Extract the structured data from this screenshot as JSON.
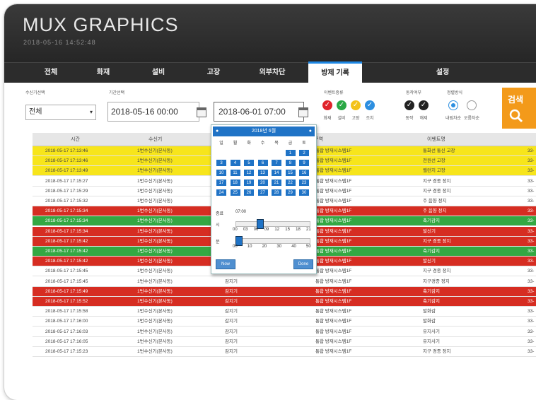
{
  "app": {
    "brand": "MUX GRAPHICS",
    "datetime": "2018-05-16 14:52:48"
  },
  "nav": {
    "tabs": [
      "전체",
      "화재",
      "설비",
      "고장",
      "외부차단",
      "방제 기록",
      "설정"
    ]
  },
  "filters": {
    "receiver_label": "수신기선택",
    "receiver_value": "전체",
    "period_label": "기간선택",
    "start": "2018-05-16 00:00",
    "end": "2018-06-01 07:00",
    "event_label": "이벤트종류",
    "events": [
      "화재",
      "설비",
      "고장",
      "조치"
    ],
    "events_colors": [
      "#e0232b",
      "#2aa845",
      "#f3c21b",
      "#2d8fe0"
    ],
    "status_label": "동작여부",
    "statuses": [
      "동작",
      "해제"
    ],
    "sort_label": "정렬방식",
    "sorts": [
      "내림차순",
      "오름차순"
    ],
    "search_label": "검색"
  },
  "table": {
    "headers": [
      "시간",
      "수신기",
      "",
      "구역",
      "이벤트명",
      ""
    ],
    "rows": [
      {
        "color": "yellow",
        "time": "2018-05-17 17:13:46",
        "rx": "1번수신기(본사동)",
        "type": "",
        "zone": "통합 방재시스템1F",
        "event": "통화선 통신 고장",
        "code": "33-"
      },
      {
        "color": "yellow",
        "time": "2018-05-17 17:13:46",
        "rx": "1번수신기(본사동)",
        "type": "",
        "zone": "통합 방재시스템1F",
        "event": "전원선 고장",
        "code": "33-"
      },
      {
        "color": "yellow",
        "time": "2018-05-17 17:13:49",
        "rx": "1번수신기(본사동)",
        "type": "",
        "zone": "통합 방재시스템1F",
        "event": "밸런지 고장",
        "code": "33-"
      },
      {
        "color": "white",
        "time": "2018-05-17 17:15:27",
        "rx": "1번수신기(본사동)",
        "type": "",
        "zone": "통합 방재시스템1F",
        "event": "지구 경종 정지",
        "code": "33-"
      },
      {
        "color": "white",
        "time": "2018-05-17 17:15:29",
        "rx": "1번수신기(본사동)",
        "type": "",
        "zone": "통합 방재시스템1F",
        "event": "지구 경종 정지",
        "code": "33-"
      },
      {
        "color": "white",
        "time": "2018-05-17 17:15:32",
        "rx": "1번수신기(본사동)",
        "type": "",
        "zone": "통합 방재시스템1F",
        "event": "주 음향 정지",
        "code": "33-"
      },
      {
        "color": "red",
        "time": "2018-05-17 17:15:34",
        "rx": "1번수신기(본사동)",
        "type": "",
        "zone": "통합 방재시스템1F",
        "event": "주 음향 정지",
        "code": "33-"
      },
      {
        "color": "green",
        "time": "2018-05-17 17:15:34",
        "rx": "1번수신기(본사동)",
        "type": "",
        "zone": "통합 방재시스템1F",
        "event": "축기감지",
        "code": "33-"
      },
      {
        "color": "red",
        "time": "2018-05-17 17:15:34",
        "rx": "1번수신기(본사동)",
        "type": "",
        "zone": "통합 방재시스템1F",
        "event": "발신기",
        "code": "33-"
      },
      {
        "color": "red",
        "time": "2018-05-17 17:15:42",
        "rx": "1번수신기(본사동)",
        "type": "",
        "zone": "통합 방재시스템1F",
        "event": "지구 경종 정지",
        "code": "33-"
      },
      {
        "color": "green",
        "time": "2018-05-17 17:15:42",
        "rx": "1번수신기(본사동)",
        "type": "",
        "zone": "통합 방재시스템1F",
        "event": "축기감지",
        "code": "33-"
      },
      {
        "color": "red",
        "time": "2018-05-17 17:15:42",
        "rx": "1번수신기(본사동)",
        "type": "감지기",
        "zone": "통합 방재시스템1F",
        "event": "발신기",
        "code": "33-"
      },
      {
        "color": "white",
        "time": "2018-05-17 17:15:45",
        "rx": "1번수신기(본사동)",
        "type": "감지기",
        "zone": "통합 방재시스템1F",
        "event": "지구 경종 정지",
        "code": "33-"
      },
      {
        "color": "white",
        "time": "2018-05-17 17:15:45",
        "rx": "1번수신기(본사동)",
        "type": "감지기",
        "zone": "통합 방재시스템1F",
        "event": "지구경종 정지",
        "code": "33-"
      },
      {
        "color": "red",
        "time": "2018-05-17 17:15:49",
        "rx": "1번수신기(본사동)",
        "type": "감지기",
        "zone": "통합 방재시스템1F",
        "event": "축기감지",
        "code": "33-"
      },
      {
        "color": "red",
        "time": "2018-05-17 17:15:52",
        "rx": "1번수신기(본사동)",
        "type": "감지기",
        "zone": "통합 방재시스템1F",
        "event": "축기감지",
        "code": "33-"
      },
      {
        "color": "white",
        "time": "2018-05-17 17:15:58",
        "rx": "1번수신기(본사동)",
        "type": "감지기",
        "zone": "통합 방재시스템1F",
        "event": "발화감",
        "code": "33-"
      },
      {
        "color": "white",
        "time": "2018-05-17 17:16:00",
        "rx": "1번수신기(본사동)",
        "type": "감지기",
        "zone": "통합 방재시스템1F",
        "event": "발화감",
        "code": "33-"
      },
      {
        "color": "white",
        "time": "2018-05-17 17:16:03",
        "rx": "1번수신기(본사동)",
        "type": "감지기",
        "zone": "통합 방재시스템1F",
        "event": "유지사기",
        "code": "33-"
      },
      {
        "color": "white",
        "time": "2018-05-17 17:16:05",
        "rx": "1번수신기(본사동)",
        "type": "감지기",
        "zone": "통합 방재시스템1F",
        "event": "유지사기",
        "code": "33-"
      },
      {
        "color": "white",
        "time": "2018-05-17 17:15:23",
        "rx": "1번수신기(본사동)",
        "type": "감지기",
        "zone": "통합 방재시스템1F",
        "event": "지구 경종 정지",
        "code": "33-"
      }
    ]
  },
  "row_colors": {
    "yellow": "#f7e51b",
    "red": "#d62d22",
    "green": "#34a843",
    "white": "#ffffff"
  },
  "picker": {
    "title": "2018년 6월",
    "weekdays": [
      "일",
      "월",
      "화",
      "수",
      "목",
      "금",
      "토"
    ],
    "days": [
      "1",
      "2",
      "3",
      "4",
      "5",
      "6",
      "7",
      "8",
      "9",
      "10",
      "11",
      "12",
      "13",
      "14",
      "15",
      "16",
      "17",
      "18",
      "19",
      "20",
      "21",
      "22",
      "23",
      "24",
      "25",
      "26",
      "27",
      "28",
      "29",
      "30"
    ],
    "time_label": "종료",
    "time_value": "07:00",
    "hour_label": "시",
    "minute_label": "분",
    "hour_ticks": [
      "00",
      "03",
      "06",
      "09",
      "12",
      "15",
      "18",
      "21"
    ],
    "minute_ticks": [
      "00",
      "10",
      "20",
      "30",
      "40",
      "50"
    ],
    "now_label": "Now",
    "done_label": "Done"
  }
}
